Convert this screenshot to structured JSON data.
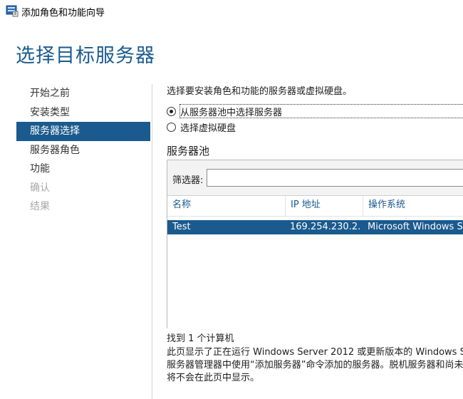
{
  "window": {
    "title": "添加角色和功能向导",
    "icon": "server-manager-icon"
  },
  "page": {
    "title": "选择目标服务器"
  },
  "nav": {
    "items": [
      {
        "label": "开始之前",
        "state": "normal"
      },
      {
        "label": "安装类型",
        "state": "normal"
      },
      {
        "label": "服务器选择",
        "state": "selected"
      },
      {
        "label": "服务器角色",
        "state": "normal"
      },
      {
        "label": "功能",
        "state": "normal"
      },
      {
        "label": "确认",
        "state": "disabled"
      },
      {
        "label": "结果",
        "state": "disabled"
      }
    ]
  },
  "content": {
    "intro": "选择要安装角色和功能的服务器或虚拟硬盘。",
    "options": [
      {
        "label": "从服务器池中选择服务器",
        "checked": true
      },
      {
        "label": "选择虚拟硬盘",
        "checked": false
      }
    ],
    "pool": {
      "heading": "服务器池",
      "filter_label": "筛选器:",
      "filter_value": "",
      "columns": [
        "名称",
        "IP 地址",
        "操作系统"
      ],
      "rows": [
        {
          "name": "Test",
          "ip": "169.254.230.2...",
          "os": "Microsoft Windows S",
          "selected": true
        }
      ]
    },
    "found_text": "找到 1 个计算机",
    "description": [
      "此页显示了正在运行 Windows Server 2012 或更新版本的 Windows S",
      "服务器管理器中使用“添加服务器”命令添加的服务器。脱机服务器和尚未",
      "将不会在此页中显示。"
    ]
  },
  "colors": {
    "accent": "#1a5a8e",
    "disabled_text": "#a8a8a8",
    "panel_bg": "#f3f3f3"
  }
}
